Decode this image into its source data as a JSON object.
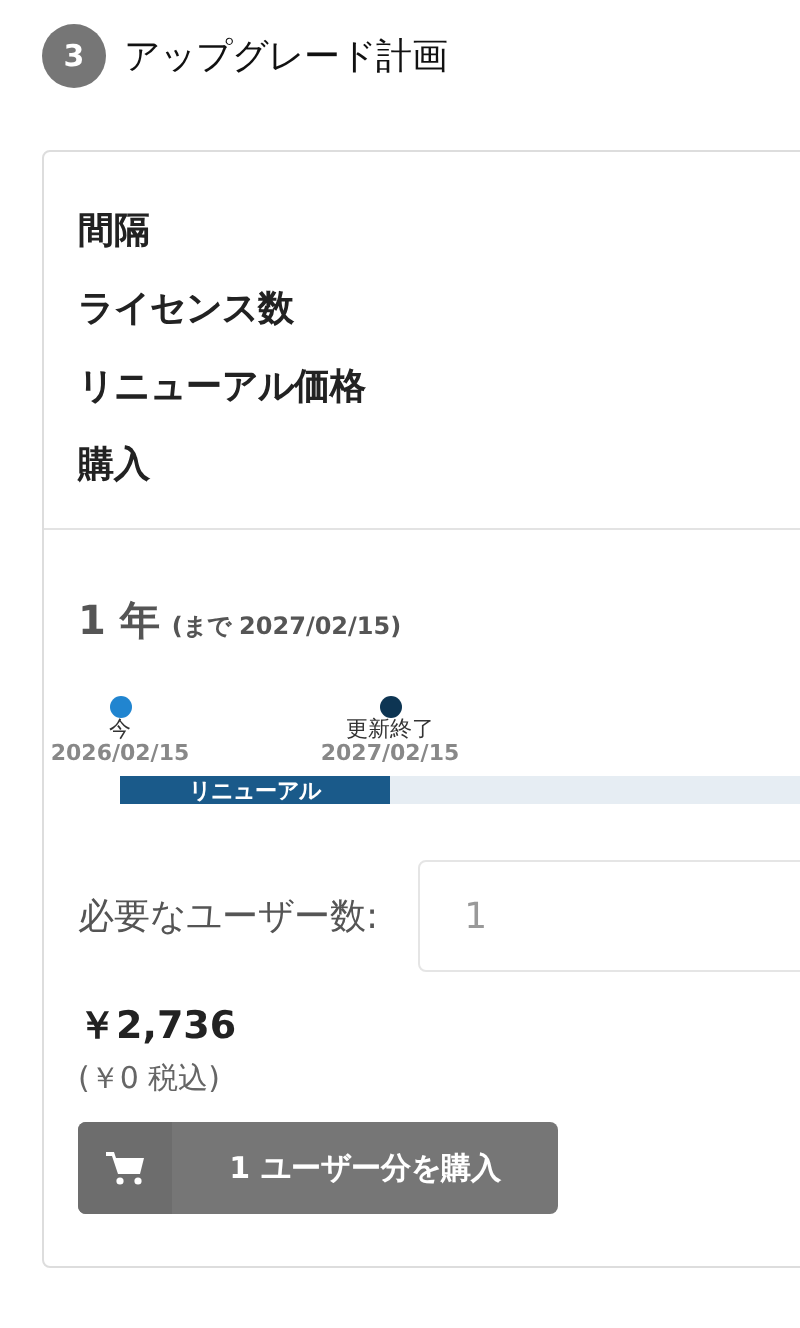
{
  "step": {
    "number": "3",
    "title": "アップグレード計画"
  },
  "summary_labels": [
    "間隔",
    "ライセンス数",
    "リニューアル価格",
    "購入"
  ],
  "period": {
    "value": "1 年",
    "until": "(まで 2027/02/15)"
  },
  "timeline": {
    "markers": [
      {
        "label": "今",
        "date": "2026/02/15",
        "color": "#2185d0"
      },
      {
        "label": "更新終了",
        "date": "2027/02/15",
        "color": "#0d3553"
      }
    ],
    "segment": {
      "label": "リニューアル",
      "level": 0.375
    }
  },
  "users": {
    "label": "必要なユーザー数:",
    "value": "1"
  },
  "price": "￥2,736",
  "tax": "(￥0 税込)",
  "buy_button": "1 ユーザー分を購入"
}
